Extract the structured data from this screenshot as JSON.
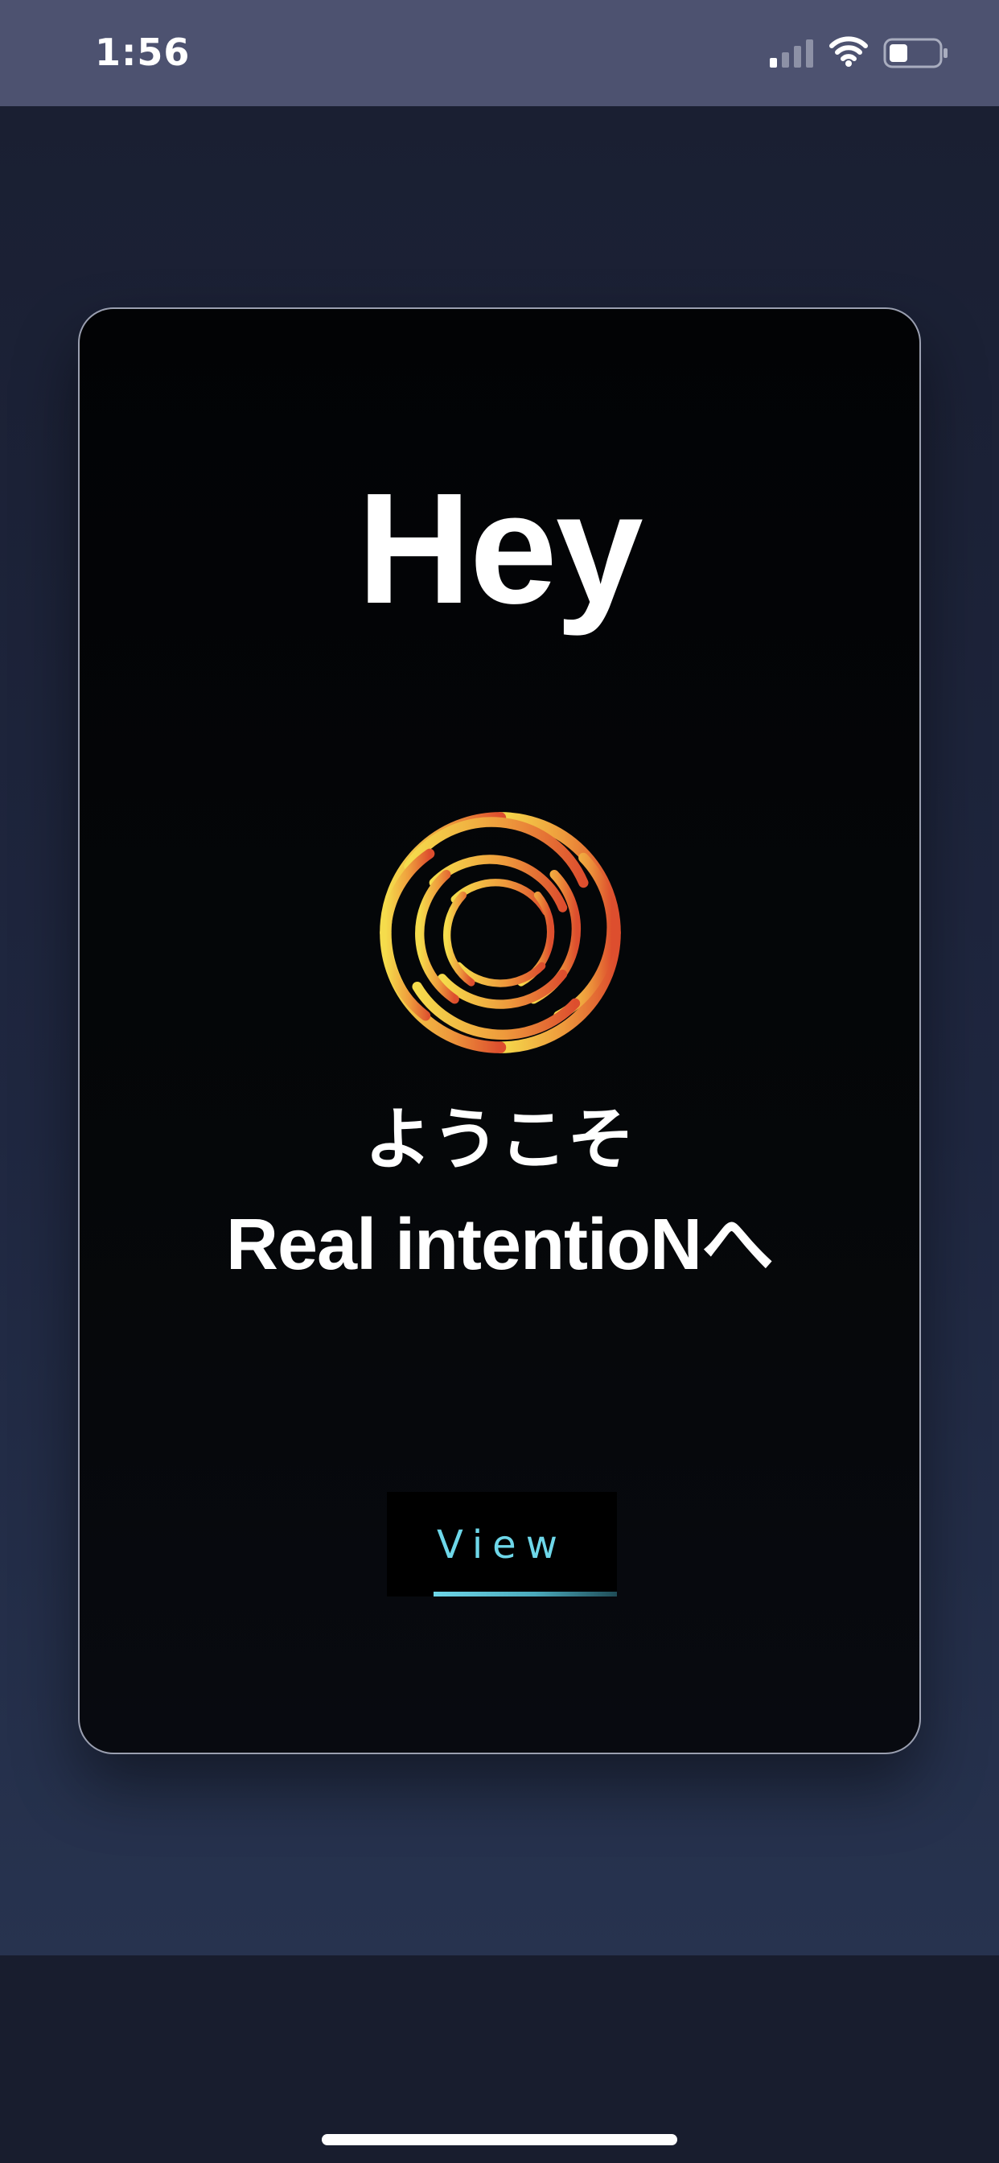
{
  "status_bar": {
    "time": "1:56"
  },
  "card": {
    "title": "Hey",
    "logo": "swirl-logo-icon",
    "welcome_line1": "ようこそ",
    "welcome_line2": "Real intentioNへ",
    "button_label": "View"
  },
  "colors": {
    "status_bar_bg": "#4d5270",
    "page_bg": "#181d2e",
    "card_bg": "#040507",
    "accent": "#6ed7e9",
    "logo_yellow": "#f5dc4c",
    "logo_orange": "#ee9a3c",
    "logo_red": "#dd4e2e"
  }
}
